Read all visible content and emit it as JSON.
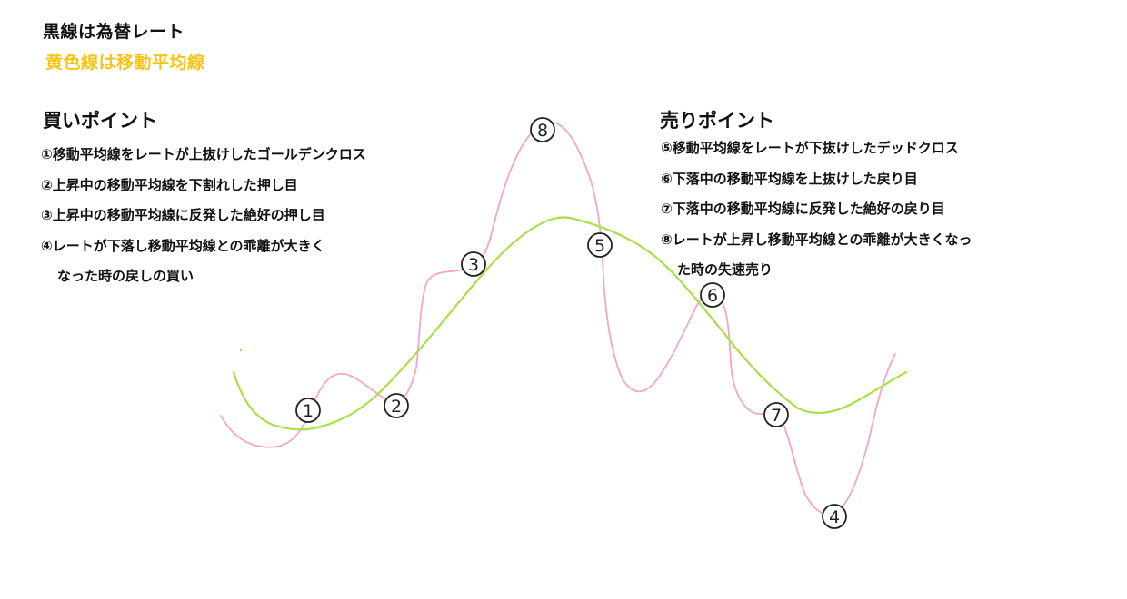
{
  "legend": {
    "black_line": "黒線は為替レート",
    "yellow_line": "黄色線は移動平均線",
    "yellow_color": "#f5c518"
  },
  "buy": {
    "title": "買いポイント",
    "items": [
      "①移動平均線をレートが上抜けしたゴールデンクロス",
      "②上昇中の移動平均線を下割れした押し目",
      "③上昇中の移動平均線に反発した絶好の押し目",
      "④レートが下落し移動平均線との乖離が大きく",
      "なった時の戻しの買い"
    ]
  },
  "sell": {
    "title": "売りポイント",
    "items": [
      "⑤移動平均線をレートが下抜けしたデッドクロス",
      "⑥下落中の移動平均線を上抜けした戻り目",
      "⑦下落中の移動平均線に反発した絶好の戻り目",
      "⑧レートが上昇し移動平均線との乖離が大きくなっ",
      "た時の失速売り"
    ]
  },
  "diagram": {
    "rate_line_color": "#f4a6c4",
    "ma_line_color": "#a8e04a",
    "markers": [
      "1",
      "2",
      "3",
      "4",
      "5",
      "6",
      "7",
      "8"
    ]
  }
}
